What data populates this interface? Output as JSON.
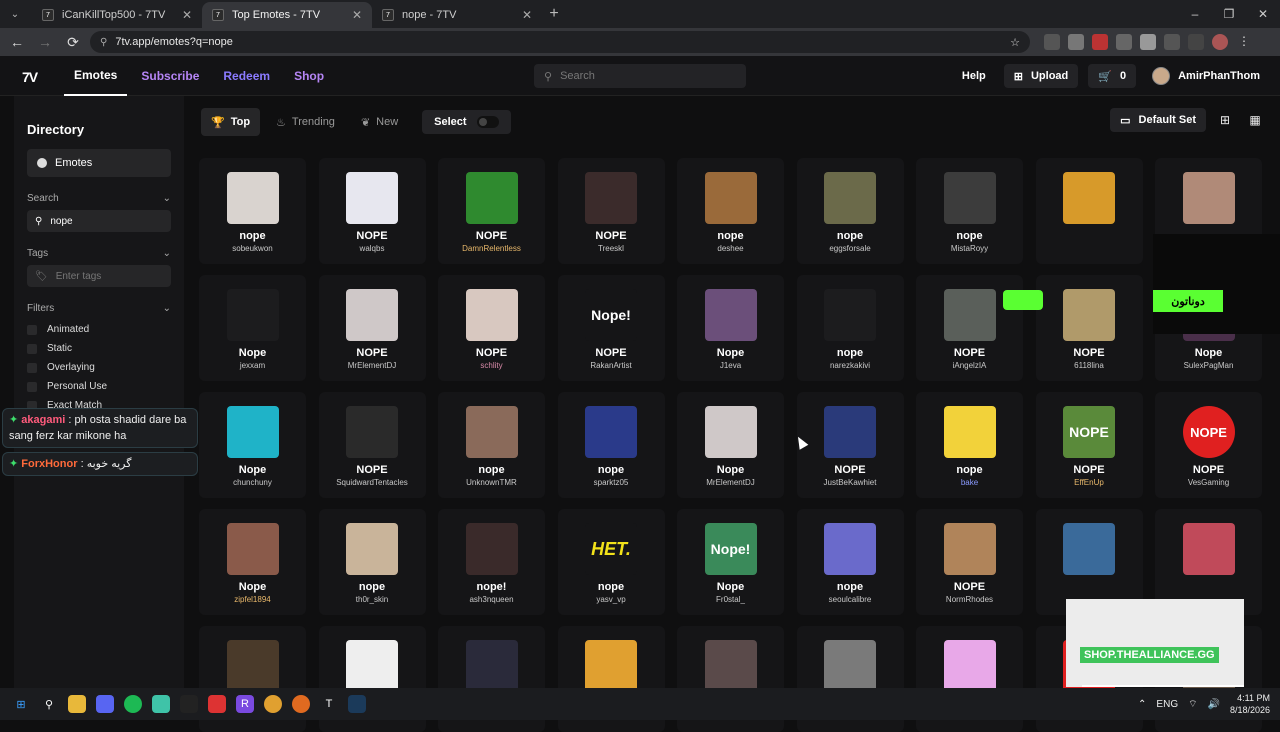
{
  "browser": {
    "tabs": [
      {
        "title": "iCanKillTop500 - 7TV",
        "active": false
      },
      {
        "title": "Top Emotes - 7TV",
        "active": true
      },
      {
        "title": "nope - 7TV",
        "active": false
      }
    ],
    "url": "7tv.app/emotes?q=nope"
  },
  "header": {
    "nav": [
      "Emotes",
      "Subscribe",
      "Redeem",
      "Shop"
    ],
    "search_placeholder": "Search",
    "help": "Help",
    "upload": "Upload",
    "cart_count": "0",
    "username": "AmirPhanThom"
  },
  "sidebar": {
    "title": "Directory",
    "directory_item": "Emotes",
    "search_label": "Search",
    "search_value": "nope",
    "tags_label": "Tags",
    "tags_placeholder": "Enter tags",
    "filters_label": "Filters",
    "filters": [
      "Animated",
      "Static",
      "Overlaying",
      "Personal Use",
      "Exact Match"
    ]
  },
  "chat": [
    {
      "user": "akagami",
      "text": ": ph osta shadid dare ba sang ferz kar mikone ha"
    },
    {
      "user": "ForxHonor",
      "text": ": گریه خوبه"
    }
  ],
  "toolbar": {
    "tabs": [
      "Top",
      "Trending",
      "New"
    ],
    "select": "Select",
    "default_set": "Default Set"
  },
  "emotes": [
    {
      "name": "nope",
      "author": "sobeukwon",
      "author_color": "#c9c9c9",
      "bg": "#d9d3cf"
    },
    {
      "name": "NOPE",
      "author": "walqbs",
      "author_color": "#c9c9c9",
      "bg": "#e7e7ef"
    },
    {
      "name": "NOPE",
      "author": "DamnRelentless",
      "author_color": "#e8b86b",
      "bg": "#2f8a2f"
    },
    {
      "name": "NOPE",
      "author": "Treeskl",
      "author_color": "#c9c9c9",
      "bg": "#3b2b2b"
    },
    {
      "name": "nope",
      "author": "deshee",
      "author_color": "#c9c9c9",
      "bg": "#9a6a3a"
    },
    {
      "name": "nope",
      "author": "eggsforsale",
      "author_color": "#c9c9c9",
      "bg": "#6b6a4a"
    },
    {
      "name": "nope",
      "author": "MistaRoyy",
      "author_color": "#c9c9c9",
      "bg": "#3c3c3c"
    },
    {
      "name": "",
      "author": "",
      "author_color": "#c9c9c9",
      "bg": "#d79a2a"
    },
    {
      "name": "",
      "author": "",
      "author_color": "#c9c9c9",
      "bg": "#b08a78"
    },
    {
      "name": "Nope",
      "author": "jexxam",
      "author_color": "#c9c9c9",
      "bg": "#1c1c1e"
    },
    {
      "name": "NOPE",
      "author": "MrElementDJ",
      "author_color": "#c9c9c9",
      "bg": "#cfc8c8"
    },
    {
      "name": "NOPE",
      "author": "schlity",
      "author_color": "#d88aa8",
      "bg": "#d8c8c0"
    },
    {
      "name": "NOPE",
      "author": "RakanArtist",
      "author_color": "#c9c9c9",
      "bg": "#151517",
      "text": "Nope!"
    },
    {
      "name": "Nope",
      "author": "J1eva",
      "author_color": "#c9c9c9",
      "bg": "#6b4f7a"
    },
    {
      "name": "nope",
      "author": "narezkakivi",
      "author_color": "#c9c9c9",
      "bg": "#1c1c1e"
    },
    {
      "name": "NOPE",
      "author": "iAngelzIA",
      "author_color": "#c9c9c9",
      "bg": "#5a5f5a"
    },
    {
      "name": "NOPE",
      "author": "6118lina",
      "author_color": "#c9c9c9",
      "bg": "#b09a6a"
    },
    {
      "name": "Nope",
      "author": "SulexPagMan",
      "author_color": "#c9c9c9",
      "bg": "#4a2f4a"
    },
    {
      "name": "Nope",
      "author": "chunchuny",
      "author_color": "#c9c9c9",
      "bg": "#1fb3c8"
    },
    {
      "name": "NOPE",
      "author": "SquidwardTentacles",
      "author_color": "#c9c9c9",
      "bg": "#2a2a2a"
    },
    {
      "name": "nope",
      "author": "UnknownTMR",
      "author_color": "#c9c9c9",
      "bg": "#8a6a5a"
    },
    {
      "name": "nope",
      "author": "sparktz05",
      "author_color": "#c9c9c9",
      "bg": "#2a3a8a"
    },
    {
      "name": "Nope",
      "author": "MrElementDJ",
      "author_color": "#c9c9c9",
      "bg": "#cfc8c8"
    },
    {
      "name": "NOPE",
      "author": "JustBeKawhiet",
      "author_color": "#c9c9c9",
      "bg": "#2a3a7a"
    },
    {
      "name": "nope",
      "author": "bake",
      "author_color": "#8a9aff",
      "bg": "#f2d23a"
    },
    {
      "name": "NOPE",
      "author": "EffEnUp",
      "author_color": "#e8b86b",
      "bg": "#5a8a3a",
      "text": "NOPE"
    },
    {
      "name": "NOPE",
      "author": "VesGaming",
      "author_color": "#c9c9c9",
      "bg": "#151517",
      "text": "NOPE"
    },
    {
      "name": "Nope",
      "author": "zipfel1894",
      "author_color": "#e8b86b",
      "bg": "#8a5a4a"
    },
    {
      "name": "nope",
      "author": "th0r_skin",
      "author_color": "#c9c9c9",
      "bg": "#c9b49a"
    },
    {
      "name": "nope!",
      "author": "ash3nqueen",
      "author_color": "#c9c9c9",
      "bg": "#3a2a2a"
    },
    {
      "name": "nope",
      "author": "yasv_vp",
      "author_color": "#c9c9c9",
      "bg": "#151517",
      "text": "HET."
    },
    {
      "name": "Nope",
      "author": "Fr0stal_",
      "author_color": "#c9c9c9",
      "bg": "#3a8a5a",
      "text": "Nope!"
    },
    {
      "name": "nope",
      "author": "seoulcalibre",
      "author_color": "#c9c9c9",
      "bg": "#6a6acb"
    },
    {
      "name": "NOPE",
      "author": "NormRhodes",
      "author_color": "#c9c9c9",
      "bg": "#b0845a"
    },
    {
      "name": "",
      "author": "",
      "author_color": "#c9c9c9",
      "bg": "#3a6a9a"
    },
    {
      "name": "",
      "author": "",
      "author_color": "#c9c9c9",
      "bg": "#c04a5a"
    },
    {
      "name": "",
      "author": "",
      "author_color": "#c9c9c9",
      "bg": "#4a3a2a"
    },
    {
      "name": "",
      "author": "",
      "author_color": "#c9c9c9",
      "bg": "#eeeeee"
    },
    {
      "name": "",
      "author": "",
      "author_color": "#c9c9c9",
      "bg": "#2a2a3a"
    },
    {
      "name": "",
      "author": "",
      "author_color": "#c9c9c9",
      "bg": "#e0a030"
    },
    {
      "name": "",
      "author": "",
      "author_color": "#c9c9c9",
      "bg": "#5a4a4a"
    },
    {
      "name": "",
      "author": "",
      "author_color": "#c9c9c9",
      "bg": "#7a7a7a"
    },
    {
      "name": "",
      "author": "",
      "author_color": "#c9c9c9",
      "bg": "#e8a8e8"
    },
    {
      "name": "",
      "author": "",
      "author_color": "#c9c9c9",
      "bg": "#e02020"
    },
    {
      "name": "",
      "author": "",
      "author_color": "#c9c9c9",
      "bg": "#6a5a4a"
    }
  ],
  "ads": {
    "arabic_text": "دوناتون",
    "shop_text": "SHOP.THEALLIANCE.GG"
  },
  "taskbar": {
    "lang": "ENG",
    "time": "4:11 PM",
    "date": "8/18/2026"
  }
}
